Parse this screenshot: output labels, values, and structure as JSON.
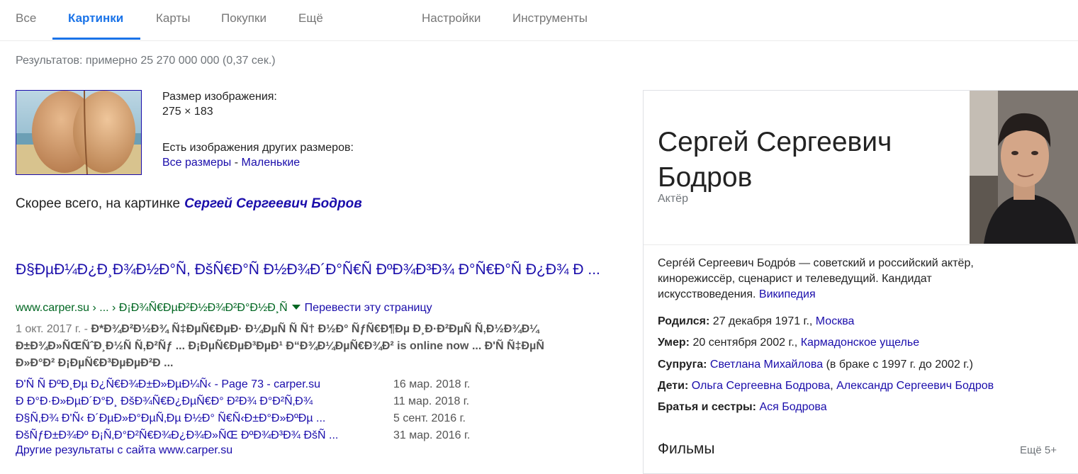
{
  "tabs": [
    {
      "label": "Все"
    },
    {
      "label": "Картинки"
    },
    {
      "label": "Карты"
    },
    {
      "label": "Покупки"
    },
    {
      "label": "Ещё"
    },
    {
      "label": "Настройки"
    },
    {
      "label": "Инструменты"
    }
  ],
  "active_tab": "Картинки",
  "stats": "Результатов: примерно 25 270 000 000 (0,37 сек.)",
  "image_info": {
    "size_label": "Размер изображения:",
    "size_value": "275 × 183",
    "other_sizes_label": "Есть изображения других размеров:",
    "all_sizes": "Все размеры",
    "separator": "-",
    "small": "Маленькие"
  },
  "best_guess": {
    "prefix": "Скорее всего, на картинке",
    "link": "Сергей Сергеевич Бодров"
  },
  "result": {
    "title": "Đ§ĐµĐ¼Đ¿Đ¸Đ¾Đ½Đ°Ñ, ĐšÑ€Đ°Ñ Đ½Đ¾Đ´Đ°Ñ€Ñ ĐºĐ¾Đ³Đ¾ Đ°Ñ€Đ°Ñ Đ¿Đ¾ Đ ...",
    "url": "www.carper.su › ... › Đ¡Đ¾Ñ€ĐµĐ²Đ½Đ¾Đ²Đ°Đ½Đ¸Ñ",
    "translate": "Перевести эту страницу",
    "snippet_date": "1 окт. 2017 г. -",
    "snippet_line1": "Đ*Đ¾Đ²Đ½Đ¾ Ñ‡ĐµÑ€ĐµĐ· Đ¼ĐµÑ Ñ Ñ† Đ½Đ° ÑƒÑ€Đ¶Đµ Đ¸Đ·Đ²ĐµÑ Ñ‚Đ½Đ¾Đ¼",
    "snippet_line2_a": "Đ±Đ¾Đ»ÑŒÑˆĐ¸Đ½Ñ Ñ‚Đ²Ñƒ ...",
    "snippet_line2_b": "Đ¡ĐµÑ€ĐµĐ³ĐµĐ¹ Đ“Đ¾Đ¼ĐµÑ€Đ¾Đ² is online now ...",
    "snippet_line2_c": "Đ'Ñ Ñ‡ĐµÑ",
    "snippet_line3": "Đ»Đ°Đ² Đ¡ĐµÑ€Đ³ĐµĐµĐ²Đ ...",
    "sub_links": [
      {
        "text": "Đ'Ñ Ñ ĐºĐ¸Đµ Đ¿Ñ€Đ¾Đ±Đ»ĐµĐ¼Ñ‹ - Page 73 - carper.su",
        "date": "16 мар. 2018 г."
      },
      {
        "text": "Đ Đ°Đ·Đ»ĐµĐ´Đ°Đ¸ ĐšĐ¾Ñ€Đ¿ĐµÑ€Đ° Đ²Đ¾ Đ°Đ²Ñ‚Đ¾",
        "date": "11 мар. 2018 г."
      },
      {
        "text": "Đ§Ñ‚Đ¾ Đ'Ñ‹ Đ´ĐµĐ»Đ°ĐµÑ‚Đµ Đ½Đ° Ñ€Ñ‹Đ±Đ°Đ»ĐºĐµ ...",
        "date": "5 сент. 2016 г."
      },
      {
        "text": "ĐšÑƒĐ±Đ¾Đº Đ¡Ñ‚Đ°Đ²Ñ€Đ¾Đ¿Đ¾Đ»ÑŒ ĐºĐ¾Đ³Đ¾ ĐšÑ ...",
        "date": "31 мар. 2016 г."
      }
    ],
    "more_from_site": "Другие результаты с сайта www.carper.su"
  },
  "knowledge_panel": {
    "name": "Сергей Сергеевич Бодров",
    "subtitle": "Актёр",
    "description": "Серге́й Сергеевич Бодро́в — советский и российский актёр, кинорежиссёр, сценарист и телеведущий. Кандидат искусствоведения.",
    "description_link": "Википедия",
    "born_label": "Родился:",
    "born_text": "27 декабря 1971 г.,",
    "born_link": "Москва",
    "died_label": "Умер:",
    "died_text": "20 сентября 2002 г.,",
    "died_link": "Кармадонское ущелье",
    "spouse_label": "Супруга:",
    "spouse_link": "Светлана Михайлова",
    "spouse_text": "(в браке с 1997 г. до 2002 г.)",
    "children_label": "Дети:",
    "child1": "Ольга Сергеевна Бодрова",
    "child_sep": ",",
    "child2": "Александр Сергеевич Бодров",
    "siblings_label": "Братья и сестры:",
    "sibling": "Ася Бодрова",
    "films_heading": "Фильмы",
    "more": "Ещё 5+"
  }
}
